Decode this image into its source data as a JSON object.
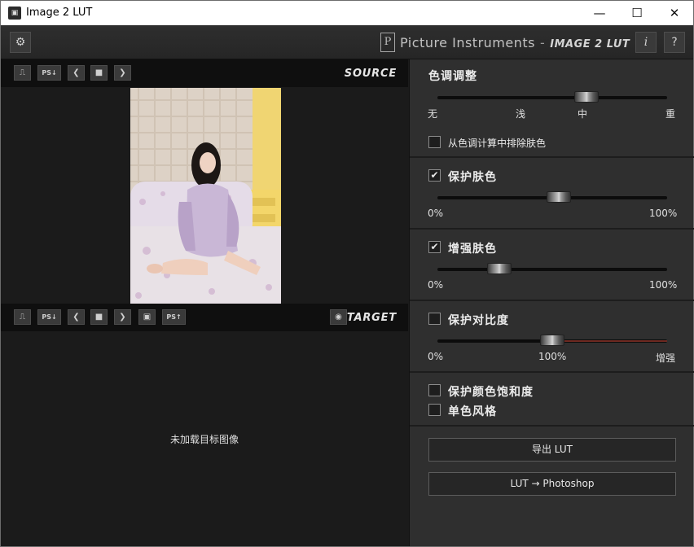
{
  "window": {
    "title": "Image 2 LUT",
    "app_icon": "image2lut-app-icon"
  },
  "header": {
    "brand": "Picture Instruments",
    "separator": "-",
    "product": "IMAGE 2 LUT",
    "info_label": "i",
    "help_label": "?"
  },
  "source": {
    "label": "SOURCE",
    "ps_import_label": "PS",
    "photo_description": "photo"
  },
  "target": {
    "label": "TARGET",
    "ps_import_label": "PS",
    "ps_export_label": "PS",
    "empty_message": "未加载目标图像"
  },
  "tone": {
    "title": "色调调整",
    "ticks": [
      "无",
      "浅",
      "中",
      "重"
    ],
    "level": 0.65,
    "exclude_skin_label": "从色调计算中排除肤色",
    "exclude_skin_checked": false
  },
  "protect_skin": {
    "label": "保护肤色",
    "checked": true,
    "min_label": "0%",
    "max_label": "100%",
    "value": 0.53
  },
  "enhance_skin": {
    "label": "增强肤色",
    "checked": true,
    "min_label": "0%",
    "max_label": "100%",
    "value": 0.27
  },
  "protect_contrast": {
    "label": "保护对比度",
    "checked": false,
    "min_label": "0%",
    "mid_label": "100%",
    "max_label": "增强",
    "value": 0.5
  },
  "protect_saturation": {
    "label": "保护颜色饱和度",
    "checked": false
  },
  "monochrome": {
    "label": "单色风格",
    "checked": false
  },
  "actions": {
    "export_label": "导出 LUT",
    "photoshop_label": "LUT → Photoshop"
  },
  "colors": {
    "panel_bg": "#2f2f2f",
    "viewer_bg": "#1b1b1b",
    "toolbar_bg": "#0f0f0f",
    "contrast_track_accent": "#6e2a22"
  },
  "icons": {
    "settings": "gear-icon",
    "histogram": "basket-icon",
    "prev": "chevron-left-icon",
    "next": "chevron-right-icon",
    "open": "folder-icon",
    "save": "floppy-icon",
    "preview": "eye-icon"
  }
}
